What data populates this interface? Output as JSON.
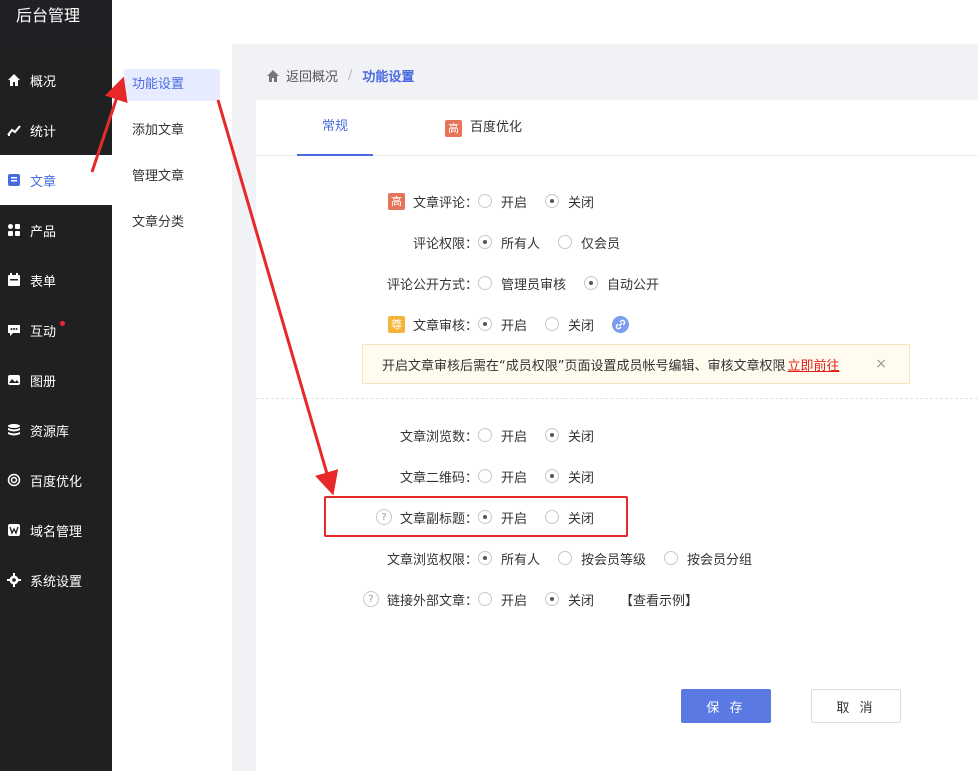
{
  "app_title": "后台管理",
  "sidebar": {
    "items": [
      {
        "label": "概况",
        "icon": "home-icon"
      },
      {
        "label": "统计",
        "icon": "chart-icon"
      },
      {
        "label": "文章",
        "icon": "article-icon",
        "active": true
      },
      {
        "label": "产品",
        "icon": "grid-icon"
      },
      {
        "label": "表单",
        "icon": "calendar-icon"
      },
      {
        "label": "互动",
        "icon": "chat-icon",
        "has_dot": true
      },
      {
        "label": "图册",
        "icon": "image-icon"
      },
      {
        "label": "资源库",
        "icon": "database-icon"
      },
      {
        "label": "百度优化",
        "icon": "target-icon"
      },
      {
        "label": "域名管理",
        "icon": "w-icon"
      },
      {
        "label": "系统设置",
        "icon": "gear-icon"
      }
    ]
  },
  "submenu": {
    "items": [
      {
        "label": "功能设置",
        "active": true
      },
      {
        "label": "添加文章"
      },
      {
        "label": "管理文章"
      },
      {
        "label": "文章分类"
      }
    ]
  },
  "breadcrumb": {
    "back": "返回概况",
    "separator": "/",
    "current": "功能设置"
  },
  "tabs": [
    {
      "label": "常规",
      "active": true
    },
    {
      "label": "百度优化",
      "badge": "高"
    }
  ],
  "settings": {
    "comment": {
      "label": "文章评论：",
      "badge": "高",
      "options": [
        "开启",
        "关闭"
      ],
      "selected": 1
    },
    "comment_permission": {
      "label": "评论权限：",
      "options": [
        "所有人",
        "仅会员"
      ],
      "selected": 0
    },
    "comment_public": {
      "label": "评论公开方式：",
      "options": [
        "管理员审核",
        "自动公开"
      ],
      "selected": 1
    },
    "review": {
      "label": "文章审核：",
      "badge": "尊",
      "options": [
        "开启",
        "关闭"
      ],
      "selected": 0
    },
    "notice": {
      "text": "开启文章审核后需在“成员权限”页面设置成员帐号编辑、审核文章权限",
      "link": "立即前往",
      "close": "×"
    },
    "views_count": {
      "label": "文章浏览数：",
      "options": [
        "开启",
        "关闭"
      ],
      "selected": 1
    },
    "qrcode": {
      "label": "文章二维码：",
      "options": [
        "开启",
        "关闭"
      ],
      "selected": 1
    },
    "subtitle": {
      "label": "文章副标题：",
      "options": [
        "开启",
        "关闭"
      ],
      "selected": 0
    },
    "view_permission": {
      "label": "文章浏览权限：",
      "options": [
        "所有人",
        "按会员等级",
        "按会员分组"
      ],
      "selected": 0
    },
    "external_link": {
      "label": "链接外部文章：",
      "options": [
        "开启",
        "关闭"
      ],
      "selected": 1,
      "example": "【查看示例】"
    }
  },
  "buttons": {
    "save": "保 存",
    "cancel": "取 消"
  },
  "help_glyph": "?",
  "colors": {
    "accent": "#4a6bdf",
    "primary_button": "#5a79e3",
    "annotation": "#e62828",
    "sidebar_bg": "#1f2022"
  }
}
